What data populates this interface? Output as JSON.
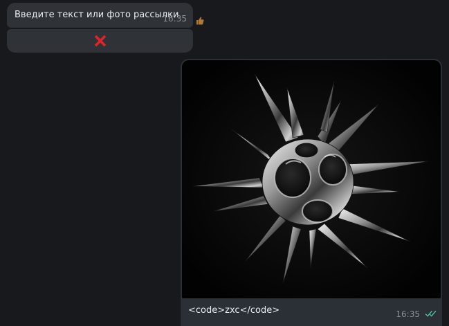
{
  "incoming_message": {
    "text": "Введите текст или фото рассылки",
    "time": "16:35",
    "reaction_icon": "thumbs-up-icon"
  },
  "inline_button": {
    "icon": "cross-icon",
    "icon_color": "#e0242a"
  },
  "outgoing_message": {
    "image": "metallic-spiky-chrome-sphere",
    "caption": "<code>zxc</code>",
    "time": "16:35",
    "status_icon": "double-check-icon",
    "status_color": "#4fbf9a"
  },
  "colors": {
    "background": "#17191d",
    "bubble": "#2f3338",
    "outgoing_bubble": "#2b3036"
  }
}
